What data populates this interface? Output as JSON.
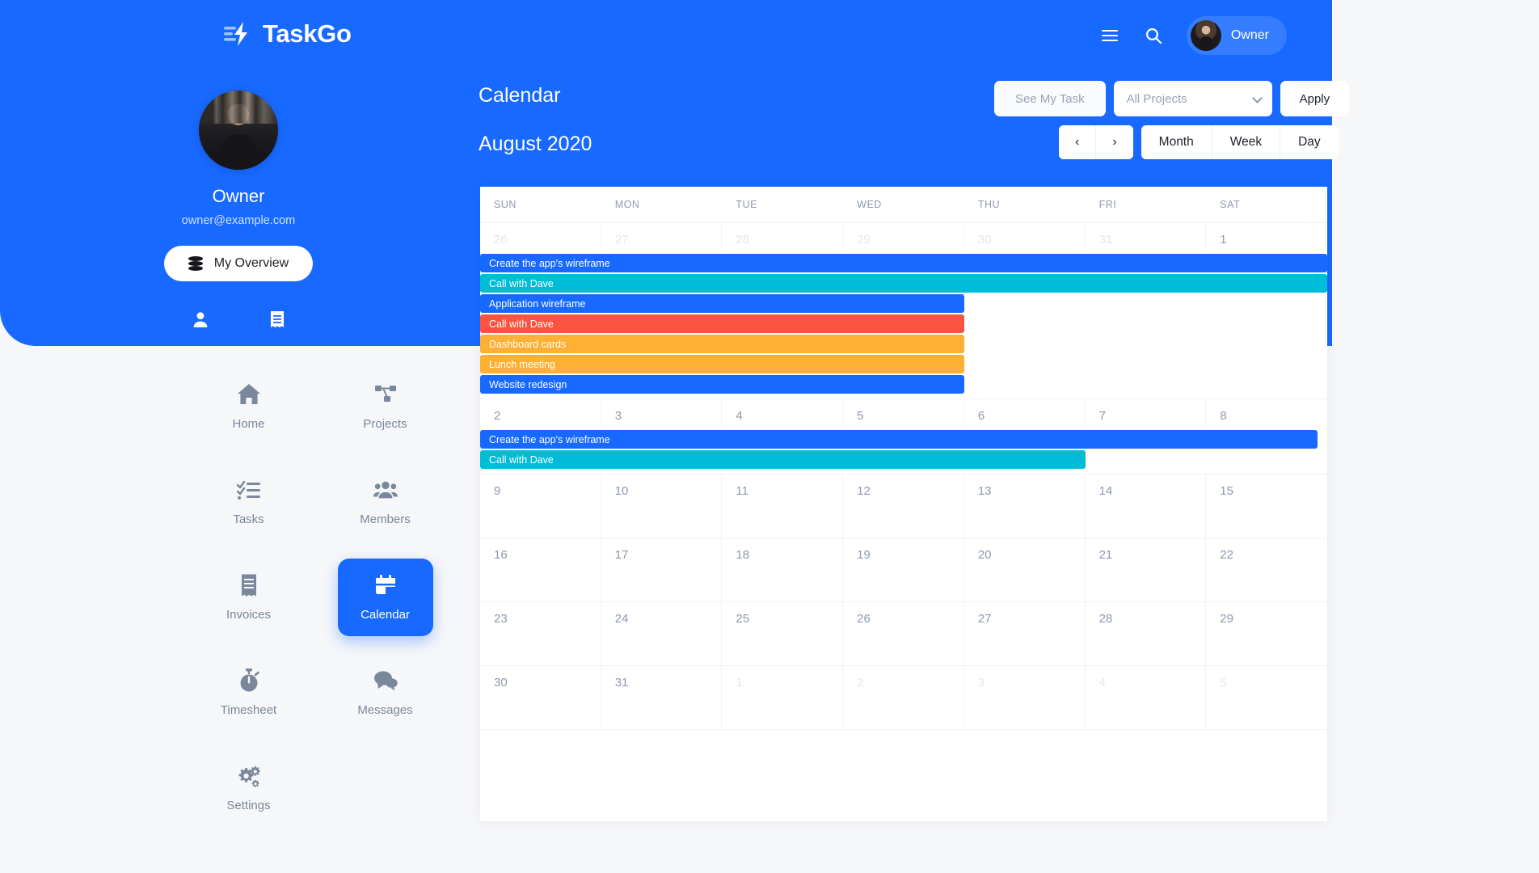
{
  "brand": {
    "name": "TaskGo",
    "accent": "#1769FF"
  },
  "topbar": {
    "menu_icon": "hamburger-icon",
    "search_icon": "search-icon",
    "user_name": "Owner"
  },
  "profile": {
    "name": "Owner",
    "email": "owner@example.com",
    "overview_button": "My Overview",
    "quick_icons": [
      {
        "name": "person-icon"
      },
      {
        "name": "receipt-icon"
      }
    ]
  },
  "sidebar": {
    "items": [
      {
        "label": "Home",
        "icon": "home-icon",
        "active": false
      },
      {
        "label": "Projects",
        "icon": "projects-icon",
        "active": false
      },
      {
        "label": "Tasks",
        "icon": "tasks-icon",
        "active": false
      },
      {
        "label": "Members",
        "icon": "members-icon",
        "active": false
      },
      {
        "label": "Invoices",
        "icon": "invoice-icon",
        "active": false
      },
      {
        "label": "Calendar",
        "icon": "calendar-icon",
        "active": true
      },
      {
        "label": "Timesheet",
        "icon": "stopwatch-icon",
        "active": false
      },
      {
        "label": "Messages",
        "icon": "messages-icon",
        "active": false
      },
      {
        "label": "Settings",
        "icon": "gear-icon",
        "active": false
      }
    ]
  },
  "page": {
    "title": "Calendar",
    "month_label": "August 2020",
    "see_my_task": "See My Task",
    "project_filter": {
      "value": "All Projects",
      "options": [
        "All Projects"
      ]
    },
    "apply": "Apply",
    "prev": "‹",
    "next": "›",
    "views": [
      "Month",
      "Week",
      "Day"
    ]
  },
  "calendar": {
    "day_headers": [
      "SUN",
      "MON",
      "TUE",
      "WED",
      "THU",
      "FRI",
      "SAT"
    ],
    "colors": {
      "blue": "#1769FF",
      "cyan": "#00BCD9",
      "red": "#FA5341",
      "orange": "#FDB033"
    },
    "weeks": [
      {
        "days": [
          {
            "num": "26",
            "muted": true
          },
          {
            "num": "27",
            "muted": true
          },
          {
            "num": "28",
            "muted": true
          },
          {
            "num": "29",
            "muted": true
          },
          {
            "num": "30",
            "muted": true
          },
          {
            "num": "31",
            "muted": true
          },
          {
            "num": "1",
            "muted": false
          }
        ],
        "events": [
          {
            "title": "Create the app's wireframe",
            "color": "#1769FF",
            "start": 0,
            "span": 7
          },
          {
            "title": "Call with Dave",
            "color": "#00BCD9",
            "start": 0,
            "span": 7
          },
          {
            "title": "Application wireframe",
            "color": "#1769FF",
            "start": 0,
            "span": 4
          },
          {
            "title": "Call with Dave",
            "color": "#FA5341",
            "start": 0,
            "span": 4
          },
          {
            "title": "Dashboard cards",
            "color": "#FDB033",
            "start": 0,
            "span": 4
          },
          {
            "title": "Lunch meeting",
            "color": "#FDB033",
            "start": 0,
            "span": 4
          },
          {
            "title": "Website redesign",
            "color": "#1769FF",
            "start": 0,
            "span": 4
          }
        ]
      },
      {
        "days": [
          {
            "num": "2",
            "muted": false
          },
          {
            "num": "3",
            "muted": false
          },
          {
            "num": "4",
            "muted": false
          },
          {
            "num": "5",
            "muted": false
          },
          {
            "num": "6",
            "muted": false
          },
          {
            "num": "7",
            "muted": false
          },
          {
            "num": "8",
            "muted": false
          }
        ],
        "events": [
          {
            "title": "Create the app's wireframe",
            "color": "#1769FF",
            "start": 0,
            "span": 6.92
          },
          {
            "title": "Call with Dave",
            "color": "#00BCD9",
            "start": 0,
            "span": 5
          }
        ]
      },
      {
        "days": [
          {
            "num": "9",
            "muted": false
          },
          {
            "num": "10",
            "muted": false
          },
          {
            "num": "11",
            "muted": false
          },
          {
            "num": "12",
            "muted": false
          },
          {
            "num": "13",
            "muted": false
          },
          {
            "num": "14",
            "muted": false
          },
          {
            "num": "15",
            "muted": false
          }
        ],
        "events": []
      },
      {
        "days": [
          {
            "num": "16",
            "muted": false
          },
          {
            "num": "17",
            "muted": false
          },
          {
            "num": "18",
            "muted": false
          },
          {
            "num": "19",
            "muted": false
          },
          {
            "num": "20",
            "muted": false
          },
          {
            "num": "21",
            "muted": false
          },
          {
            "num": "22",
            "muted": false
          }
        ],
        "events": []
      },
      {
        "days": [
          {
            "num": "23",
            "muted": false
          },
          {
            "num": "24",
            "muted": false
          },
          {
            "num": "25",
            "muted": false
          },
          {
            "num": "26",
            "muted": false
          },
          {
            "num": "27",
            "muted": false
          },
          {
            "num": "28",
            "muted": false
          },
          {
            "num": "29",
            "muted": false
          }
        ],
        "events": []
      },
      {
        "days": [
          {
            "num": "30",
            "muted": false
          },
          {
            "num": "31",
            "muted": false
          },
          {
            "num": "1",
            "muted": true
          },
          {
            "num": "2",
            "muted": true
          },
          {
            "num": "3",
            "muted": true
          },
          {
            "num": "4",
            "muted": true
          },
          {
            "num": "5",
            "muted": true
          }
        ],
        "events": []
      }
    ]
  }
}
